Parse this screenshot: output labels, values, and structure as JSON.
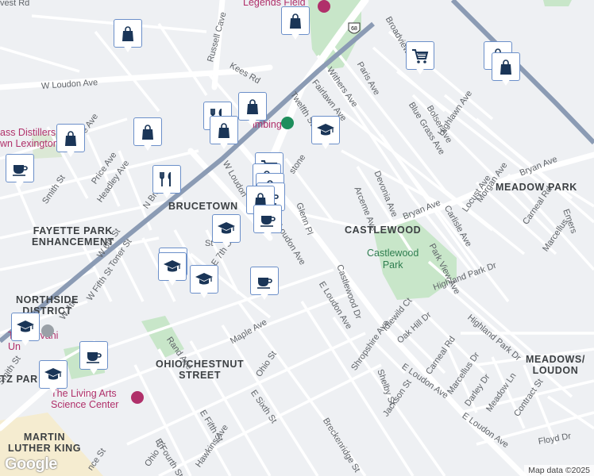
{
  "map": {
    "attribution": "Map data ©2025",
    "logo": "Google",
    "route_shield": "68",
    "colors": {
      "background": "#eef0f3",
      "road": "#ffffff",
      "railway": "#8b9bb4",
      "park": "#c8e6c9",
      "marker_icon": "#1a3557",
      "marker_border": "#6b8fc9",
      "poi_pink": "#b0306a"
    }
  },
  "areas": {
    "meadow_park": "MEADOW PARK",
    "brucetown": "BRUCETOWN",
    "castlewood": "CASTLEWOOD",
    "fayette_park": "FAYETTE PARK\nENHANCEMENT",
    "northside": "NORTHSIDE\nDISTRICT",
    "ohio_chestnut": "OHIO/CHESTNUT\nSTREET",
    "meadows_loudon": "MEADOWS/\nLOUDON",
    "martin_luther_king": "MARTIN\nLUTHER KING",
    "ritz_park_partial": "TZ PAR"
  },
  "parks": {
    "castlewood_park": "Castlewood\nPark"
  },
  "pois": {
    "legends_field": "Legends Field",
    "distillers": "ass Distillers\nwn Lexington",
    "transylvania": "Transylvani\nUn",
    "living_arts": "The Living Arts\nScience Center",
    "climbing": "imbing"
  },
  "streets": [
    {
      "text": "vest Rd"
    },
    {
      "text": "Russell Cave"
    },
    {
      "text": "W Loudon Ave"
    },
    {
      "text": "Kees Rd"
    },
    {
      "text": "Paris Ave"
    },
    {
      "text": "Broadview"
    },
    {
      "text": "Withers Ave"
    },
    {
      "text": "Fairlawn Ave"
    },
    {
      "text": "Twelfth St"
    },
    {
      "text": "Blue Grass Ave"
    },
    {
      "text": "Bolser Ave"
    },
    {
      "text": "Highlawn Ave"
    },
    {
      "text": "Bellaire Ave"
    },
    {
      "text": "Price Ave"
    },
    {
      "text": "Headley Ave"
    },
    {
      "text": "Smith St"
    },
    {
      "text": "N Broadway"
    },
    {
      "text": "W Loudon"
    },
    {
      "text": "stone"
    },
    {
      "text": "Glenn Pl"
    },
    {
      "text": "Arceme Ave"
    },
    {
      "text": "Devonia Ave"
    },
    {
      "text": "Bryan Ave"
    },
    {
      "text": "Bryan Ave"
    },
    {
      "text": "Carlisle Ave"
    },
    {
      "text": "Locust Ave"
    },
    {
      "text": "Morgan Ave"
    },
    {
      "text": "Park View Ave"
    },
    {
      "text": "Emers"
    },
    {
      "text": "Carneal Rd"
    },
    {
      "text": "Marcellus"
    },
    {
      "text": "W 6th St"
    },
    {
      "text": "Toner St"
    },
    {
      "text": "W Fifth St"
    },
    {
      "text": "E 7th St"
    },
    {
      "text": "ma Ave"
    },
    {
      "text": "York"
    },
    {
      "text": "Loudon Ave"
    },
    {
      "text": "E Loudon Ave"
    },
    {
      "text": "Castlewood Dr"
    },
    {
      "text": "Highland Park Dr"
    },
    {
      "text": "Idlewild Ct"
    },
    {
      "text": "Oak Hill Dr"
    },
    {
      "text": "Highland Park Dr"
    },
    {
      "text": "Carneal Rd"
    },
    {
      "text": "Marcellus Dr"
    },
    {
      "text": "Darley Dr"
    },
    {
      "text": "Meadow Ln"
    },
    {
      "text": "Contract St"
    },
    {
      "text": "Floyd Dr"
    },
    {
      "text": "E Loudon Ave"
    },
    {
      "text": "E Loudon Ave"
    },
    {
      "text": "Rand Ave"
    },
    {
      "text": "Maple Ave"
    },
    {
      "text": "Ohio St"
    },
    {
      "text": "E Sixth St"
    },
    {
      "text": "Shropshire Ave"
    },
    {
      "text": "Shelby St"
    },
    {
      "text": "Jackson St"
    },
    {
      "text": "Breckenridge St"
    },
    {
      "text": "E Fifth St"
    },
    {
      "text": "E Fourth St"
    },
    {
      "text": "Ohio St"
    },
    {
      "text": "Hawkins Ave"
    },
    {
      "text": "W 4th"
    },
    {
      "text": "Smith St"
    },
    {
      "text": "nce St"
    },
    {
      "text": "St"
    }
  ],
  "markers": [
    {
      "icon": "shopping-bag"
    },
    {
      "icon": "shopping-bag"
    },
    {
      "icon": "shopping-cart"
    },
    {
      "icon": "shopping-bag"
    },
    {
      "icon": "shopping-bag"
    },
    {
      "icon": "shopping-bag"
    },
    {
      "icon": "restaurant"
    },
    {
      "icon": "shopping-bag"
    },
    {
      "icon": "school"
    },
    {
      "icon": "shopping-bag"
    },
    {
      "icon": "shopping-bag"
    },
    {
      "icon": "cafe"
    },
    {
      "icon": "restaurant"
    },
    {
      "icon": "shopping-cart"
    },
    {
      "icon": "shopping-bag"
    },
    {
      "icon": "shopping-bag"
    },
    {
      "icon": "cafe"
    },
    {
      "icon": "shopping-bag"
    },
    {
      "icon": "cafe"
    },
    {
      "icon": "school"
    },
    {
      "icon": "restaurant"
    },
    {
      "icon": "school"
    },
    {
      "icon": "school"
    },
    {
      "icon": "cafe"
    },
    {
      "icon": "school"
    },
    {
      "icon": "cafe"
    },
    {
      "icon": "school"
    }
  ]
}
